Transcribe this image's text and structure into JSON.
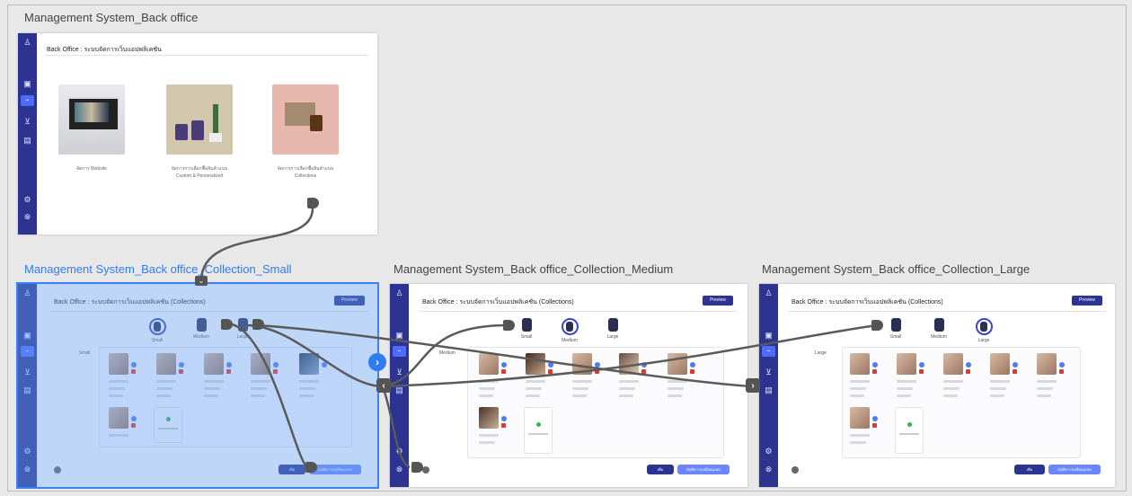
{
  "frames": {
    "hub": {
      "title": "Management System_Back office",
      "header": "Back Office : ระบบจัดการเว็บแอปพลิเคชัน",
      "items": [
        {
          "caption": "จัดการ Website"
        },
        {
          "caption": "จัดการการเลือกซื้อสินค้าแบบ Custom & Personalized"
        },
        {
          "caption": "จัดการการเลือกซื้อสินค้าแบบ Collections"
        }
      ]
    },
    "small": {
      "title": "Management System_Back office_Collection_Small",
      "header": "Back Office : ระบบจัดการเว็บแอปพลิเคชัน (Collections)",
      "size_label": "Small",
      "active_tab": "Small"
    },
    "medium": {
      "title": "Management System_Back office_Collection_Medium",
      "header": "Back Office : ระบบจัดการเว็บแอปพลิเคชัน (Collections)",
      "size_label": "Medium",
      "active_tab": "Medium"
    },
    "large": {
      "title": "Management System_Back office_Collection_Large",
      "header": "Back Office : ระบบจัดการเว็บแอปพลิเคชัน (Collections)",
      "size_label": "Large",
      "active_tab": "Large"
    }
  },
  "tabs": [
    "Small",
    "Medium",
    "Large"
  ],
  "ui": {
    "preview_label": "Preview",
    "add_label": "เพิ่ม",
    "save_label": "บันทึกการเปลี่ยนแปลง",
    "add_item_label": "เพิ่ม"
  },
  "sidebar_icons": [
    "user-icon",
    "image-icon",
    "active-nav-icon",
    "cart-icon",
    "layers-icon",
    "settings-icon",
    "logout-icon"
  ],
  "colors": {
    "sidebar": "#2c3391",
    "accent": "#3946c8",
    "selection": "#3b82f6",
    "canvas": "#e8e8e8",
    "connector": "#555555"
  }
}
